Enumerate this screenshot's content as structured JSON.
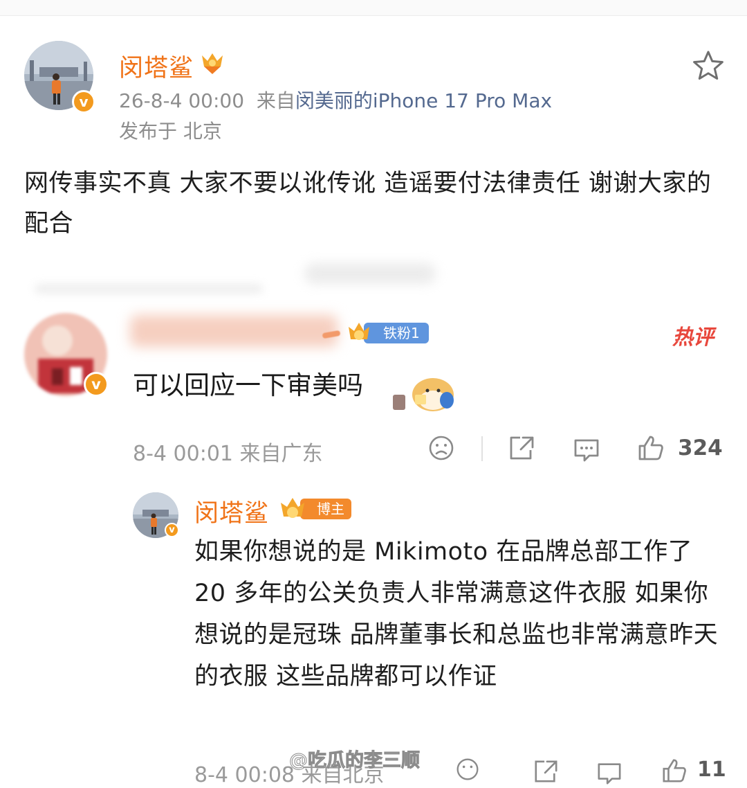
{
  "post": {
    "author_name": "闵塔鲨",
    "timestamp": "26-8-4 00:00",
    "source_prefix": "来自",
    "source_device": "闵美丽的iPhone 17 Pro Max",
    "location": "发布于 北京",
    "verified_badge": "v",
    "body_text": "网传事实不真 大家不要以讹传讹 造谣要付法律责任 谢谢大家的配合"
  },
  "hot_comment": {
    "fan_badge_label": "铁粉1",
    "hot_tag": "热评",
    "text": "可以回应一下审美吗",
    "timestamp": "8-4 00:01",
    "location": "来自广东",
    "like_count": "324"
  },
  "author_reply": {
    "author_name": "闵塔鲨",
    "badge_label": "博主",
    "text": "如果你想说的是 Mikimoto 在品牌总部工作了 20 多年的公关负责人非常满意这件衣服 如果你想说的是冠珠 品牌董事长和总监也非常满意昨天的衣服 这些品牌都可以作证",
    "timestamp": "8-4 00:08",
    "location": "来自北京",
    "like_count": "11"
  },
  "watermark": "@吃瓜的李三顺",
  "colors": {
    "author_orange": "#f07318",
    "link_blue": "#54698f",
    "hot_red": "#e8473c",
    "meta_gray": "#8d8d8d"
  },
  "icons": [
    "star-icon",
    "share-icon",
    "comment-icon",
    "like-icon",
    "sad-face-icon",
    "crown-medal-icon"
  ]
}
